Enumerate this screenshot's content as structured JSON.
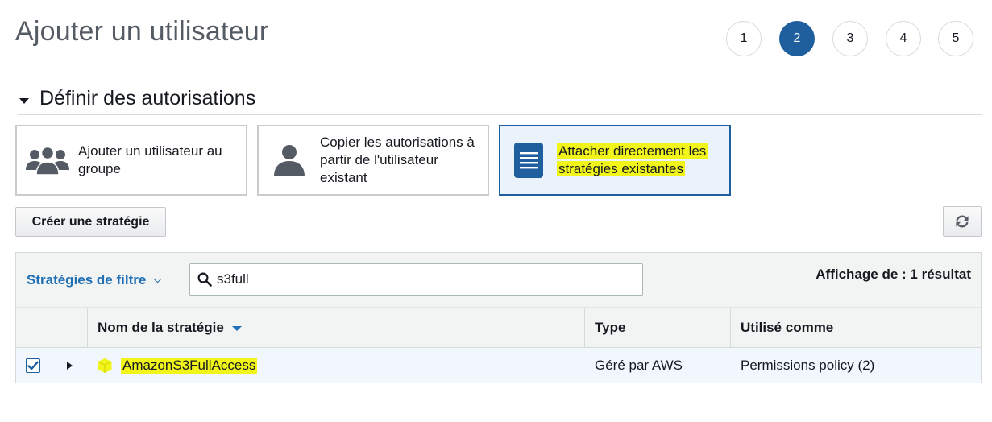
{
  "page": {
    "title": "Ajouter un utilisateur"
  },
  "steps": {
    "items": [
      "1",
      "2",
      "3",
      "4",
      "5"
    ],
    "active": "2"
  },
  "permissions": {
    "section_title": "Définir des autorisations",
    "options": [
      {
        "label": "Ajouter un utilisateur au groupe",
        "icon": "user-group-icon",
        "selected": false
      },
      {
        "label": "Copier les autorisations à partir de l'utilisateur existant",
        "icon": "user-icon",
        "selected": false
      },
      {
        "label": "Attacher directement les stratégies existantes",
        "icon": "document-icon",
        "selected": true
      }
    ]
  },
  "actions": {
    "create_policy_label": "Créer une stratégie",
    "refresh_icon": "refresh-icon"
  },
  "table": {
    "filter_label": "Stratégies de filtre",
    "search_value": "s3full",
    "search_icon": "search-icon",
    "result_count": "Affichage de : 1 résultat",
    "columns": {
      "name": "Nom de la stratégie",
      "type": "Type",
      "used_as": "Utilisé comme"
    },
    "rows": [
      {
        "checked": true,
        "name": "AmazonS3FullAccess",
        "type": "Géré par AWS",
        "used_as": "Permissions policy (2)",
        "icon": "policy-cube-icon"
      }
    ]
  },
  "colors": {
    "primary": "#1f5f9e",
    "link": "#1f6fb5",
    "highlight": "#f2f51a",
    "selected_bg": "#eaf3fb",
    "policy_icon": "#f2f51a"
  }
}
